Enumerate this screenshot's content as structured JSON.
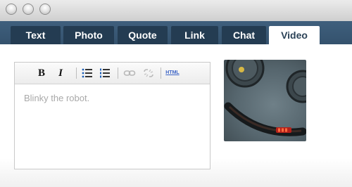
{
  "window": {
    "buttons": [
      "close",
      "minimize",
      "zoom"
    ]
  },
  "tabs": [
    {
      "label": "Text",
      "active": false
    },
    {
      "label": "Photo",
      "active": false
    },
    {
      "label": "Quote",
      "active": false
    },
    {
      "label": "Link",
      "active": false
    },
    {
      "label": "Chat",
      "active": false
    },
    {
      "label": "Video",
      "active": true
    }
  ],
  "toolbar": {
    "bold": "B",
    "italic": "I",
    "html": "HTML",
    "icons": [
      "bold-icon",
      "italic-icon",
      "bulleted-list-icon",
      "numbered-list-icon",
      "link-icon",
      "unlink-icon",
      "html-icon"
    ]
  },
  "editor": {
    "text": "Blinky the robot."
  },
  "colors": {
    "tabbar": "#3f5f7d",
    "tab": "#243c52",
    "active_tab": "#ffffff",
    "html_link": "#3b63c5"
  }
}
